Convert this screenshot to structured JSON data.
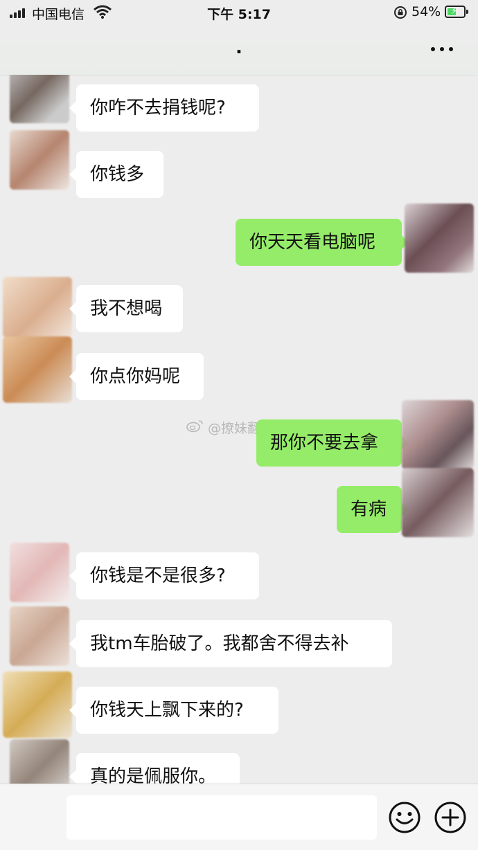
{
  "status_bar": {
    "carrier": "中国电信",
    "time": "下午 5:17",
    "battery": "54%",
    "battery_level": 0.54
  },
  "nav": {
    "title": ".",
    "more_icon": "more-dots-icon"
  },
  "watermark": "@撩妹翻车现场",
  "messages": [
    {
      "side": "in",
      "text": "你咋不去捐钱呢?"
    },
    {
      "side": "in",
      "text": "你钱多"
    },
    {
      "side": "out",
      "text": "你天天看电脑呢"
    },
    {
      "side": "in",
      "text": "我不想喝"
    },
    {
      "side": "in",
      "text": "你点你妈呢"
    },
    {
      "side": "out",
      "text": "那你不要去拿"
    },
    {
      "side": "out",
      "text": "有病"
    },
    {
      "side": "in",
      "text": "你钱是不是很多?"
    },
    {
      "side": "in",
      "text": "我tm车胎破了。我都舍不得去补"
    },
    {
      "side": "in",
      "text": "你钱天上飘下来的?"
    },
    {
      "side": "in",
      "text": "真的是佩服你。"
    }
  ],
  "input_bar": {
    "input_value": "",
    "emoji_icon": "emoji-smile-icon",
    "plus_icon": "plus-circle-icon"
  },
  "colors": {
    "background": "#ededed",
    "incoming_bubble": "#ffffff",
    "outgoing_bubble": "#95ec69"
  }
}
